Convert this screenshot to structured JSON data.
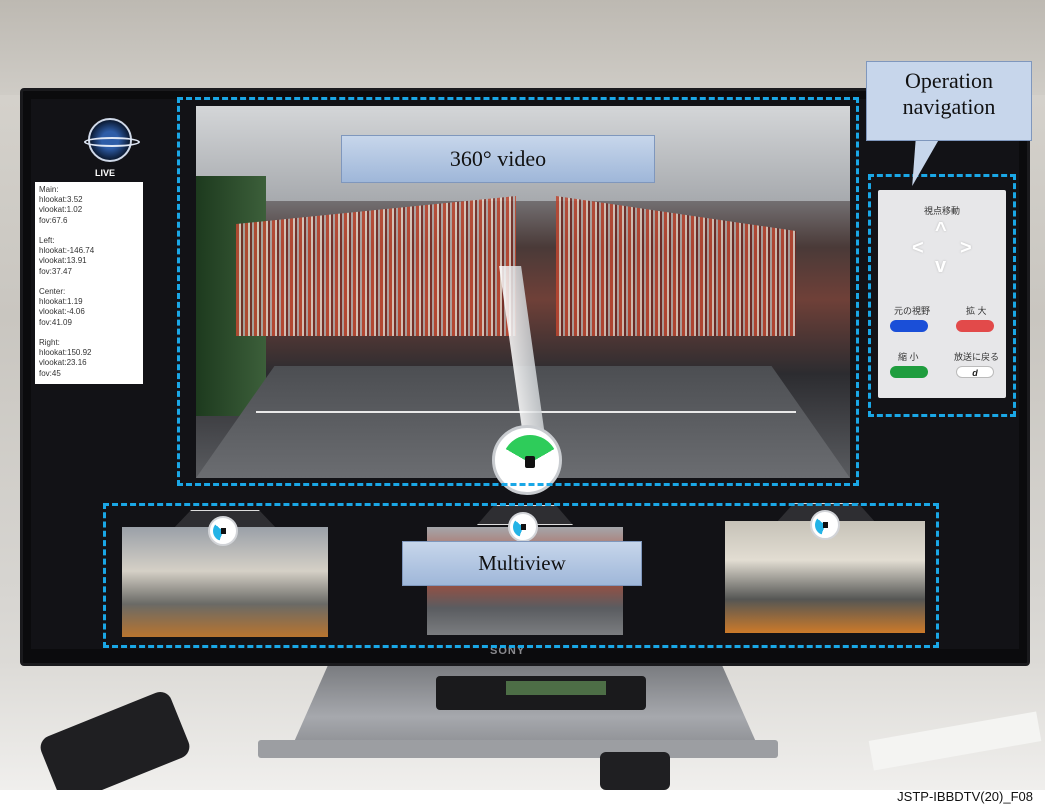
{
  "annotations": {
    "video_label": "360° video",
    "ops_label": "Operation navigation",
    "multiview_label": "Multiview"
  },
  "caption": "JSTP-IBBDTV(20)_F08",
  "tv": {
    "brand": "SONY",
    "live_badge": "LIVE",
    "status_text": "Main:\nhlookat:3.52\nvlookat:1.02\nfov:67.6\n\nLeft:\nhlookat:-146.74\nvlookat:13.91\nfov:37.47\n\nCenter:\nhlookat:1.19\nvlookat:-4.06\nfov:41.09\n\nRight:\nhlookat:150.92\nvlookat:23.16\nfov:45"
  },
  "ops_panel": {
    "title": "視点移動",
    "reset_fov": "元の視野",
    "zoom_in": "拡 大",
    "zoom_out": "縮 小",
    "back_to_broadcast": "放送に戻る",
    "d_key": "d",
    "arrows": {
      "up": "^",
      "down": "v",
      "left": "<",
      "right": ">"
    },
    "colors": {
      "blue": "#1a4fd8",
      "red": "#e24a4a",
      "green": "#1f9d3e"
    }
  }
}
